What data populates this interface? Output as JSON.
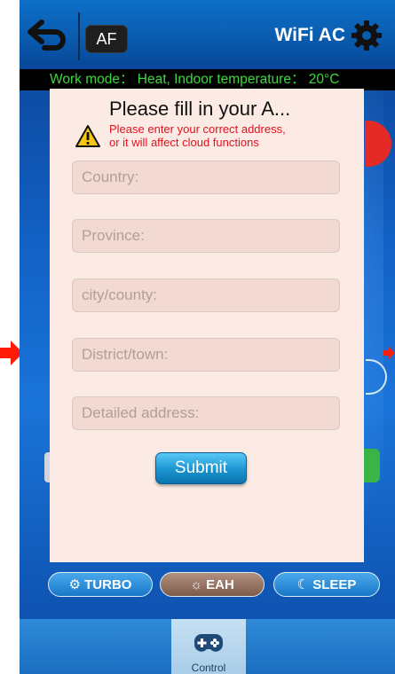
{
  "header": {
    "back_icon": "back-arrow-icon",
    "af_label": "AF",
    "title": "WiFi AC",
    "settings_icon": "gear-icon"
  },
  "status": {
    "text": "Work mode： Heat,  Indoor temperature： 20°C"
  },
  "dialog": {
    "title": "Please fill in your A...",
    "warning_icon": "warning-triangle-icon",
    "warning_line1": "Please enter your correct address,",
    "warning_line2": "or it will affect cloud functions",
    "fields": [
      {
        "placeholder": "Country:",
        "value": ""
      },
      {
        "placeholder": "Province:",
        "value": ""
      },
      {
        "placeholder": "city/county:",
        "value": ""
      },
      {
        "placeholder": "District/town:",
        "value": ""
      },
      {
        "placeholder": "Detailed address:",
        "value": ""
      }
    ],
    "submit_label": "Submit"
  },
  "modes": {
    "turbo_label": "TURBO",
    "eah_label": "EAH",
    "sleep_label": "SLEEP"
  },
  "tabbar": {
    "control_label": "Control",
    "control_icon": "gamepad-icon"
  },
  "colors": {
    "status_text": "#39d83c",
    "warning_text": "#e3101e",
    "dialog_bg": "#fcebe4",
    "submit_bg": "#1a94cf"
  }
}
